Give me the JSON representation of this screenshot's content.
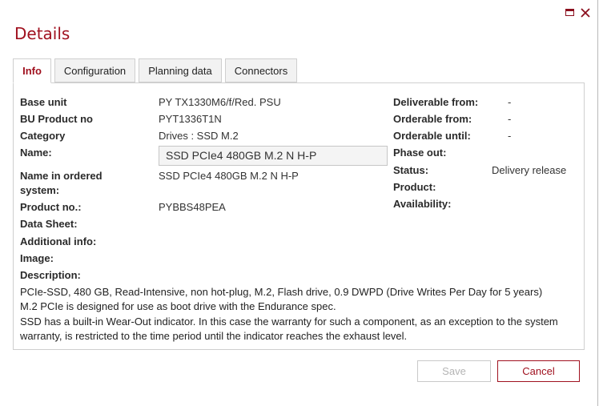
{
  "window": {
    "title": "Details",
    "maximize_icon": "maximize-icon",
    "close_icon": "close-icon",
    "accent_color": "#a0111f"
  },
  "tabs": [
    {
      "label": "Info",
      "active": true
    },
    {
      "label": "Configuration",
      "active": false
    },
    {
      "label": "Planning data",
      "active": false
    },
    {
      "label": "Connectors",
      "active": false
    }
  ],
  "info": {
    "left": {
      "base_unit": {
        "label": "Base unit",
        "value": "PY TX1330M6/f/Red. PSU"
      },
      "bu_product_no": {
        "label": "BU Product no",
        "value": "PYT1336T1N"
      },
      "category": {
        "label": "Category",
        "value": "Drives : SSD M.2"
      },
      "name": {
        "label": "Name:",
        "value": "SSD PCIe4 480GB M.2 N H-P"
      },
      "name_in_ordered_system": {
        "label_line1": "Name in ordered",
        "label_line2": "system:",
        "value": "SSD PCIe4 480GB M.2 N H-P"
      },
      "product_no": {
        "label": "Product no.:",
        "value": "PYBBS48PEA"
      },
      "data_sheet": {
        "label": "Data Sheet:"
      },
      "additional_info": {
        "label": "Additional info:"
      },
      "image": {
        "label": "Image:"
      },
      "description": {
        "label": "Description:"
      }
    },
    "right": {
      "deliverable_from": {
        "label": "Deliverable from:",
        "value": "-"
      },
      "orderable_from": {
        "label": "Orderable from:",
        "value": "-"
      },
      "orderable_until": {
        "label": "Orderable until:",
        "value": "-"
      },
      "phase_out": {
        "label": "Phase out:"
      },
      "status": {
        "label": "Status:",
        "value": "Delivery release"
      },
      "product": {
        "label": "Product:"
      },
      "availability": {
        "label": "Availability:"
      }
    },
    "description_lines": [
      "PCIe-SSD, 480 GB, Read-Intensive, non hot-plug, M.2, Flash drive, 0.9 DWPD (Drive Writes Per Day for 5 years)",
      "M.2 PCIe is designed for use as boot drive with the Endurance spec.",
      "SSD has a built-in Wear-Out indicator. In this case the warranty for such a component, as an exception to the system",
      "warranty, is restricted to the time period until the indicator reaches the exhaust level."
    ]
  },
  "footer": {
    "save_label": "Save",
    "cancel_label": "Cancel",
    "save_enabled": false
  }
}
